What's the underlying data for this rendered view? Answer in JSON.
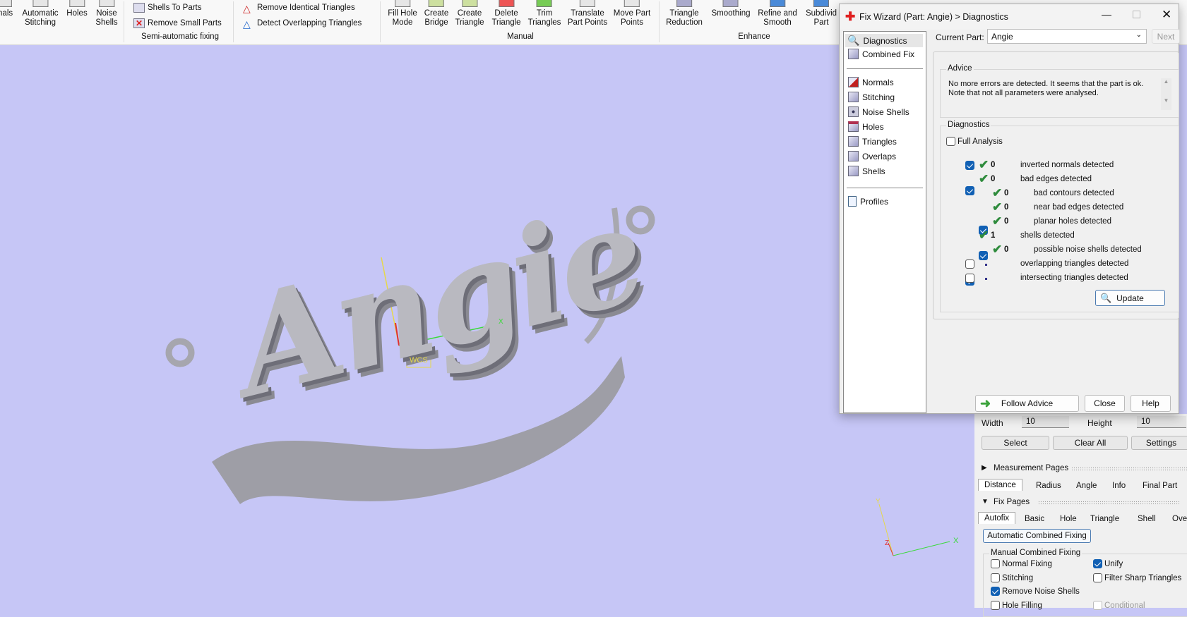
{
  "ribbon": {
    "large_buttons": [
      {
        "label": "mals",
        "line2": ""
      },
      {
        "label": "Automatic",
        "line2": "Stitching"
      },
      {
        "label": "Holes",
        "line2": ""
      },
      {
        "label": "Noise",
        "line2": "Shells"
      },
      {
        "label": "Fill Hole",
        "line2": "Mode"
      },
      {
        "label": "Create",
        "line2": "Bridge"
      },
      {
        "label": "Create",
        "line2": "Triangle"
      },
      {
        "label": "Delete",
        "line2": "Triangle"
      },
      {
        "label": "Trim",
        "line2": "Triangles"
      },
      {
        "label": "Translate",
        "line2": "Part Points"
      },
      {
        "label": "Move Part",
        "line2": "Points"
      },
      {
        "label": "Triangle",
        "line2": "Reduction"
      },
      {
        "label": "Smoothing",
        "line2": ""
      },
      {
        "label": "Refine and",
        "line2": "Smooth"
      },
      {
        "label": "Subdivid",
        "line2": "Part"
      }
    ],
    "small_buttons": [
      "Shells To Parts",
      "Remove Small Parts",
      "Remove Identical Triangles",
      "Detect Overlapping Triangles"
    ],
    "groups": [
      "Semi-automatic fixing",
      "Manual",
      "Enhance"
    ]
  },
  "viewport": {
    "model_text": "Angie",
    "wcs_label": "WCS",
    "axis_x": "X",
    "axis_y": "Y",
    "axis_z": "Z"
  },
  "dialog": {
    "title": "Fix Wizard (Part: Angie) > Diagnostics",
    "nav_top": [
      "Diagnostics",
      "Combined Fix"
    ],
    "nav_mid": [
      "Normals",
      "Stitching",
      "Noise Shells",
      "Holes",
      "Triangles",
      "Overlaps",
      "Shells"
    ],
    "nav_bottom": [
      "Profiles"
    ],
    "current_part_label": "Current Part:",
    "current_part_value": "Angie",
    "next_label": "Next",
    "advice_title": "Advice",
    "advice_text1": "No more errors are detected. It seems that the part is ok.",
    "advice_text2": "Note that not all parameters were analysed.",
    "diagnostics_title": "Diagnostics",
    "full_analysis": "Full Analysis",
    "rows": [
      {
        "checked": true,
        "count": "0",
        "label": "inverted normals detected",
        "level": 0,
        "status": "ok",
        "has_cb": true
      },
      {
        "checked": true,
        "count": "0",
        "label": "bad edges detected",
        "level": 0,
        "status": "ok",
        "has_cb": true
      },
      {
        "checked": false,
        "count": "0",
        "label": "bad contours detected",
        "level": 1,
        "status": "ok",
        "has_cb": false
      },
      {
        "checked": true,
        "count": "0",
        "label": "near bad edges detected",
        "level": 1,
        "status": "ok",
        "has_cb": true
      },
      {
        "checked": true,
        "count": "0",
        "label": "planar holes detected",
        "level": 1,
        "status": "ok",
        "has_cb": true
      },
      {
        "checked": true,
        "count": "1",
        "label": "shells detected",
        "level": 0,
        "status": "ok",
        "has_cb": true
      },
      {
        "checked": false,
        "count": "0",
        "label": "possible noise shells detected",
        "level": 1,
        "status": "ok",
        "has_cb": false
      },
      {
        "checked": false,
        "count": "",
        "label": "overlapping triangles detected",
        "level": 0,
        "status": "pending",
        "has_cb": true
      },
      {
        "checked": false,
        "count": "",
        "label": "intersecting triangles detected",
        "level": 0,
        "status": "pending",
        "has_cb": true
      }
    ],
    "update_label": "Update",
    "follow_advice_label": "Follow Advice",
    "close_label": "Close",
    "help_label": "Help"
  },
  "right_panel": {
    "width_label": "Width",
    "width_value": "10",
    "height_label": "Height",
    "height_value": "10",
    "select_label": "Select",
    "clear_all_label": "Clear All",
    "settings_label": "Settings",
    "measurement_pages": "Measurement Pages",
    "measurement_tabs": [
      "Distance",
      "Radius",
      "Angle",
      "Info",
      "Final Part"
    ],
    "fix_pages": "Fix Pages",
    "fix_tabs": [
      "Autofix",
      "Basic",
      "Hole",
      "Triangle",
      "Shell",
      "Over"
    ],
    "auto_combined": "Automatic Combined Fixing",
    "manual_combined": "Manual Combined Fixing",
    "options": [
      {
        "label": "Normal Fixing",
        "checked": false
      },
      {
        "label": "Unify",
        "checked": true
      },
      {
        "label": "Stitching",
        "checked": false
      },
      {
        "label": "Filter Sharp Triangles",
        "checked": false
      },
      {
        "label": "Remove Noise Shells",
        "checked": true
      },
      {
        "label": "Hole Filling",
        "checked": false
      },
      {
        "label": "Conditional",
        "checked": false
      }
    ]
  }
}
